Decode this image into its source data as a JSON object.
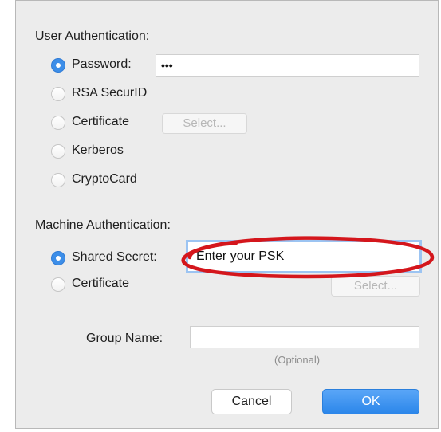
{
  "user_auth": {
    "title": "User Authentication:",
    "options": [
      {
        "label": "Password:",
        "selected": true
      },
      {
        "label": "RSA SecurID",
        "selected": false
      },
      {
        "label": "Certificate",
        "selected": false
      },
      {
        "label": "Kerberos",
        "selected": false
      },
      {
        "label": "CryptoCard",
        "selected": false
      }
    ],
    "password_value": "•••",
    "select_label": "Select..."
  },
  "machine_auth": {
    "title": "Machine Authentication:",
    "options": [
      {
        "label": "Shared Secret:",
        "selected": true
      },
      {
        "label": "Certificate",
        "selected": false
      }
    ],
    "shared_secret_placeholder": "Enter your PSK",
    "select_label": "Select..."
  },
  "group": {
    "label": "Group Name:",
    "value": "",
    "hint": "(Optional)"
  },
  "buttons": {
    "cancel": "Cancel",
    "ok": "OK"
  },
  "colors": {
    "accent": "#3d8ee8",
    "annotation": "#d4161c",
    "dialog_bg": "#ececec"
  }
}
